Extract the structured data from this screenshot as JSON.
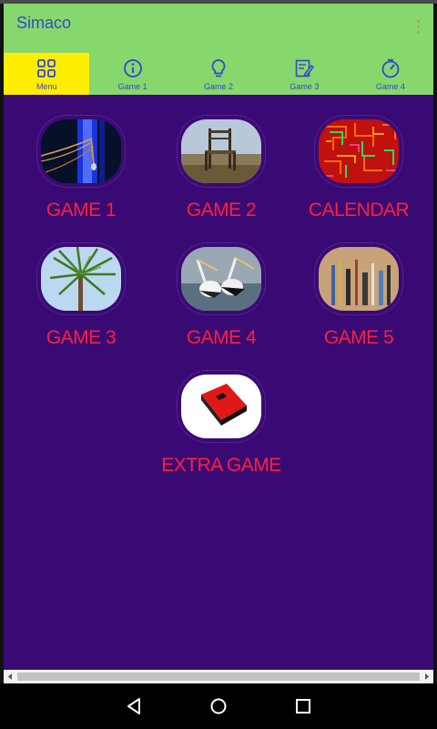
{
  "app": {
    "title": "Simaco",
    "overflow_icon": "more-vert-icon"
  },
  "tabs": [
    {
      "label": "Menu",
      "icon": "grid-icon",
      "active": true
    },
    {
      "label": "Game 1",
      "icon": "info-icon",
      "active": false
    },
    {
      "label": "Game 2",
      "icon": "lightbulb-icon",
      "active": false
    },
    {
      "label": "Game 3",
      "icon": "edit-note-icon",
      "active": false
    },
    {
      "label": "Game 4",
      "icon": "timer-icon",
      "active": false
    }
  ],
  "tiles": [
    {
      "label": "GAME 1",
      "image": "microphone-stage-image"
    },
    {
      "label": "GAME 2",
      "image": "old-chair-image"
    },
    {
      "label": "CALENDAR",
      "image": "colorful-maze-image"
    },
    {
      "label": "GAME 3",
      "image": "palm-tree-image"
    },
    {
      "label": "GAME 4",
      "image": "pelicans-image"
    },
    {
      "label": "GAME 5",
      "image": "tools-on-wood-image"
    },
    {
      "label": "EXTRA GAME",
      "image": "red-book-image"
    }
  ],
  "nav": {
    "back": "back-icon",
    "home": "home-icon",
    "recents": "recents-icon"
  },
  "colors": {
    "appbar": "#86d86d",
    "active_tab": "#ffee00",
    "content_bg": "#3a0a74",
    "tile_label": "#ff1f3d",
    "title": "#3548c8"
  }
}
